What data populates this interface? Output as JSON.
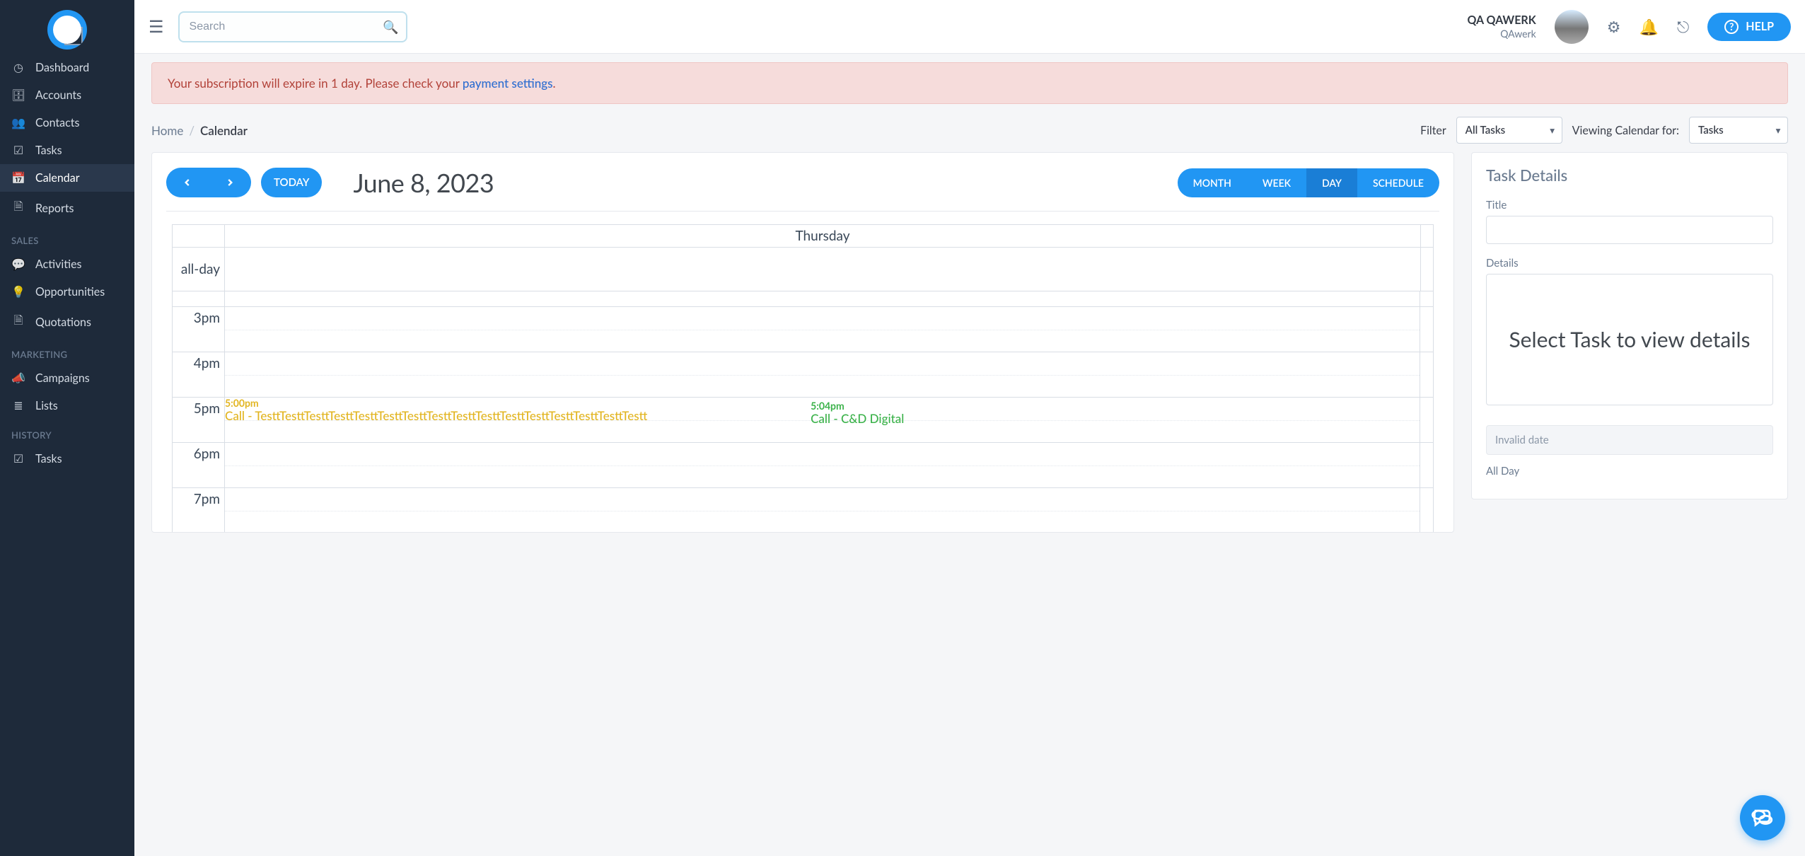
{
  "topbar": {
    "search_placeholder": "Search",
    "user_name": "QA QAWERK",
    "user_org": "QAwerk",
    "help_label": "HELP"
  },
  "sidebar": {
    "items": [
      {
        "label": "Dashboard"
      },
      {
        "label": "Accounts"
      },
      {
        "label": "Contacts"
      },
      {
        "label": "Tasks"
      },
      {
        "label": "Calendar"
      },
      {
        "label": "Reports"
      }
    ],
    "section_sales": "SALES",
    "sales_items": [
      {
        "label": "Activities"
      },
      {
        "label": "Opportunities"
      },
      {
        "label": "Quotations"
      }
    ],
    "section_marketing": "MARKETING",
    "marketing_items": [
      {
        "label": "Campaigns"
      },
      {
        "label": "Lists"
      }
    ],
    "section_history": "HISTORY",
    "history_items": [
      {
        "label": "Tasks"
      }
    ]
  },
  "alert": {
    "prefix": "Your subscription will expire in 1 day. Please check your ",
    "link": "payment settings",
    "suffix": "."
  },
  "breadcrumb": {
    "home": "Home",
    "current": "Calendar"
  },
  "filters": {
    "filter_label": "Filter",
    "filter_value": "All Tasks",
    "viewing_label": "Viewing Calendar for:",
    "viewing_value": "Tasks"
  },
  "calendar": {
    "today_label": "TODAY",
    "title": "June 8, 2023",
    "views": {
      "month": "MONTH",
      "week": "WEEK",
      "day": "DAY",
      "schedule": "SCHEDULE"
    },
    "dayname": "Thursday",
    "all_day": "all-day",
    "hours": [
      "3pm",
      "4pm",
      "5pm",
      "6pm",
      "7pm"
    ],
    "events": [
      {
        "time": "5:00pm",
        "title": "Call - TesttTesttTesttTesttTesttTesttTesttTesttTesttTesttTesttTesttTesttTesttTesttTestt"
      },
      {
        "time": "5:04pm",
        "title": "Call - C&D Digital"
      }
    ]
  },
  "details": {
    "panel_title": "Task Details",
    "title_label": "Title",
    "details_label": "Details",
    "placeholder": "Select Task to view details",
    "invalid_date": "Invalid date",
    "all_day_label": "All Day"
  }
}
